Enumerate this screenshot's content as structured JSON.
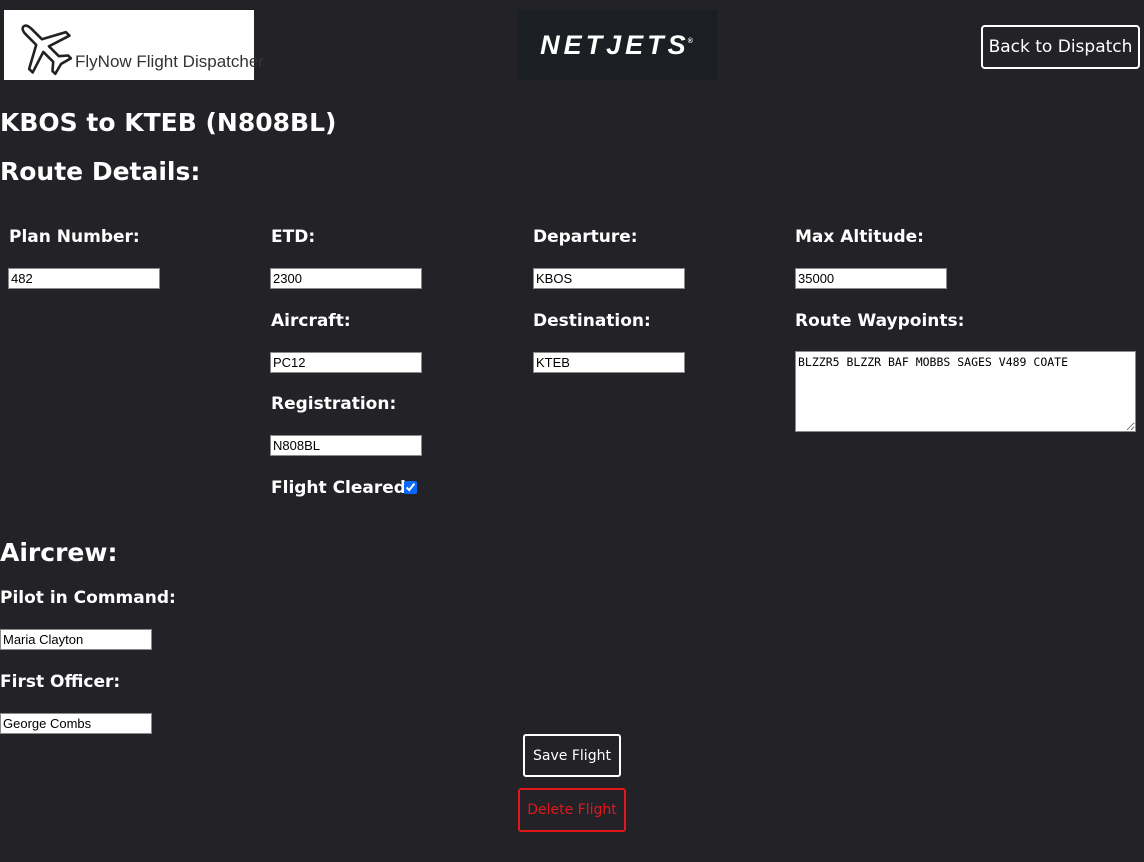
{
  "header": {
    "logo_text": "FlyNow Flight Dispatcher",
    "brand_logo_text": "NETJETS",
    "brand_logo_mark": "®",
    "back_button_label": "Back to Dispatch"
  },
  "page": {
    "title": "KBOS to KTEB (N808BL)",
    "route_heading": "Route Details:",
    "aircrew_heading": "Aircrew:"
  },
  "route": {
    "plan_number": {
      "label": "Plan Number:",
      "value": "482"
    },
    "etd": {
      "label": "ETD:",
      "value": "2300"
    },
    "departure": {
      "label": "Departure:",
      "value": "KBOS"
    },
    "max_altitude": {
      "label": "Max Altitude:",
      "value": "35000"
    },
    "aircraft": {
      "label": "Aircraft:",
      "value": "PC12"
    },
    "destination": {
      "label": "Destination:",
      "value": "KTEB"
    },
    "waypoints": {
      "label": "Route Waypoints:",
      "value": "BLZZR5 BLZZR BAF MOBBS SAGES V489 COATE"
    },
    "registration": {
      "label": "Registration:",
      "value": "N808BL"
    },
    "flight_cleared": {
      "label": "Flight Cleared",
      "checked": true
    }
  },
  "aircrew": {
    "pilot_in_command": {
      "label": "Pilot in Command:",
      "value": "Maria Clayton"
    },
    "first_officer": {
      "label": "First Officer:",
      "value": "George Combs"
    }
  },
  "actions": {
    "save_label": "Save Flight",
    "delete_label": "Delete Flight"
  },
  "colors": {
    "background": "#232327",
    "text": "#ffffff",
    "danger": "#e3161c",
    "checkbox_accent": "#0a66ff"
  },
  "icons": {
    "logo": "airplane-icon"
  }
}
